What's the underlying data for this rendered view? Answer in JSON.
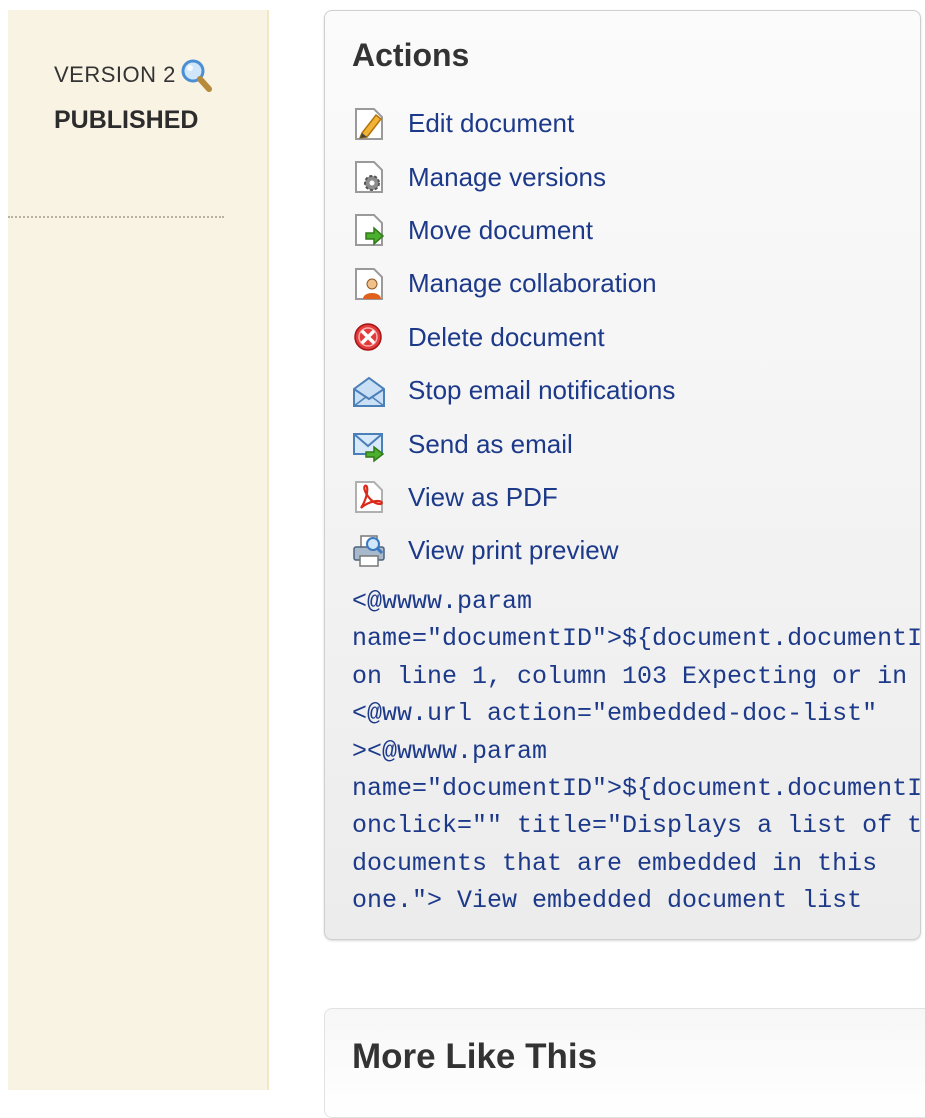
{
  "sidebar": {
    "version_label": "Version 2",
    "status": "PUBLISHED"
  },
  "actions": {
    "title": "Actions",
    "items": [
      {
        "label": "Edit document",
        "icon": "pencil-page-icon"
      },
      {
        "label": "Manage versions",
        "icon": "gear-page-icon"
      },
      {
        "label": "Move document",
        "icon": "arrow-page-icon"
      },
      {
        "label": "Manage collaboration",
        "icon": "person-page-icon"
      },
      {
        "label": "Delete document",
        "icon": "delete-icon"
      },
      {
        "label": "Stop email notifications",
        "icon": "open-envelope-icon"
      },
      {
        "label": "Send as email",
        "icon": "send-email-icon"
      },
      {
        "label": "View as PDF",
        "icon": "pdf-icon"
      },
      {
        "label": "View print preview",
        "icon": "printer-icon"
      }
    ],
    "error_text": "<@wwww.param\nname=\"documentID\">${document.documentID}\non line 1, column 103 Expecting or in\n<@ww.url action=\"embedded-doc-list\"\n><@wwww.param\nname=\"documentID\">${document.documentID}\nonclick=\"\" title=\"Displays a list of the\ndocuments that are embedded in this\none.\"> View embedded document list"
  },
  "more_like_this": {
    "title": "More Like This"
  },
  "colors": {
    "link": "#1d3a8a",
    "sidebar_bg": "#f9f3e3",
    "panel_border": "#cfcfcf"
  }
}
